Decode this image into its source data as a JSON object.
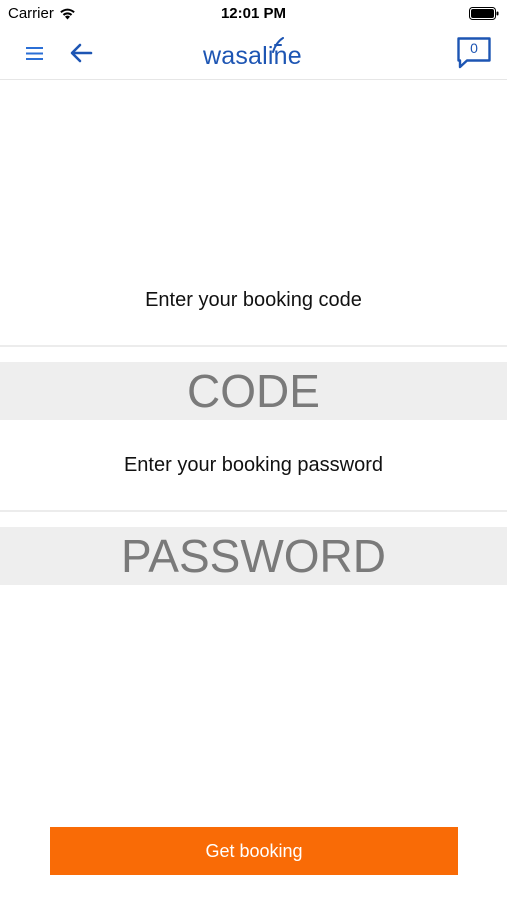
{
  "status_bar": {
    "carrier": "Carrier",
    "time": "12:01 PM",
    "icons": [
      "wifi-icon",
      "battery-icon"
    ]
  },
  "nav": {
    "menu_icon": "hamburger-icon",
    "back_icon": "arrow-left-icon",
    "logo_text": "wasaline",
    "chat_icon": "chat-bubble-icon",
    "chat_count": "0",
    "accent_color": "#1d55b3"
  },
  "form": {
    "code_label": "Enter your booking code",
    "code_placeholder": "CODE",
    "code_value": "",
    "password_label": "Enter your booking password",
    "password_placeholder": "PASSWORD",
    "password_value": ""
  },
  "actions": {
    "get_booking_label": "Get booking",
    "button_color": "#f96b06"
  }
}
